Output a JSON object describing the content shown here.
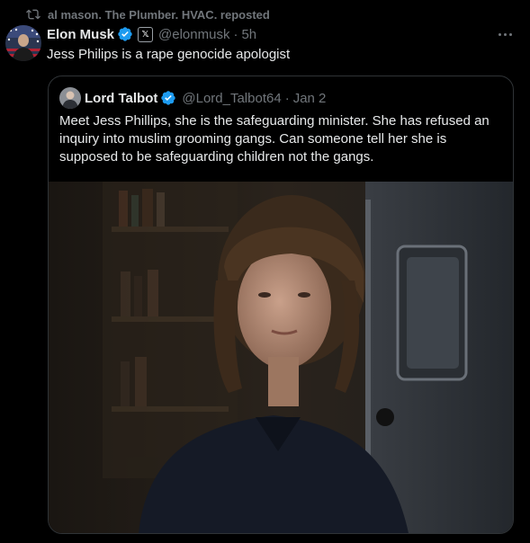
{
  "repost": {
    "icon": "repost-icon",
    "text": "al mason. The Plumber. HVAC. reposted"
  },
  "tweet": {
    "author_name": "Elon Musk",
    "author_handle": "@elonmusk",
    "separator": "·",
    "time": "5h",
    "x_badge": "𝕏",
    "text": "Jess Philips is a rape genocide apologist"
  },
  "quoted": {
    "author_name": "Lord Talbot",
    "author_handle": "@Lord_Talbot64",
    "separator": "·",
    "date": "Jan 2",
    "text": "Meet Jess Phillips, she is the safeguarding minister. She has refused an inquiry into muslim grooming gangs. Can someone tell her she is supposed to be safeguarding children not the gangs."
  },
  "colors": {
    "background": "#000000",
    "text": "#e7e9ea",
    "muted": "#71767b",
    "verified": "#1d9bf0",
    "border": "#2f3336"
  }
}
